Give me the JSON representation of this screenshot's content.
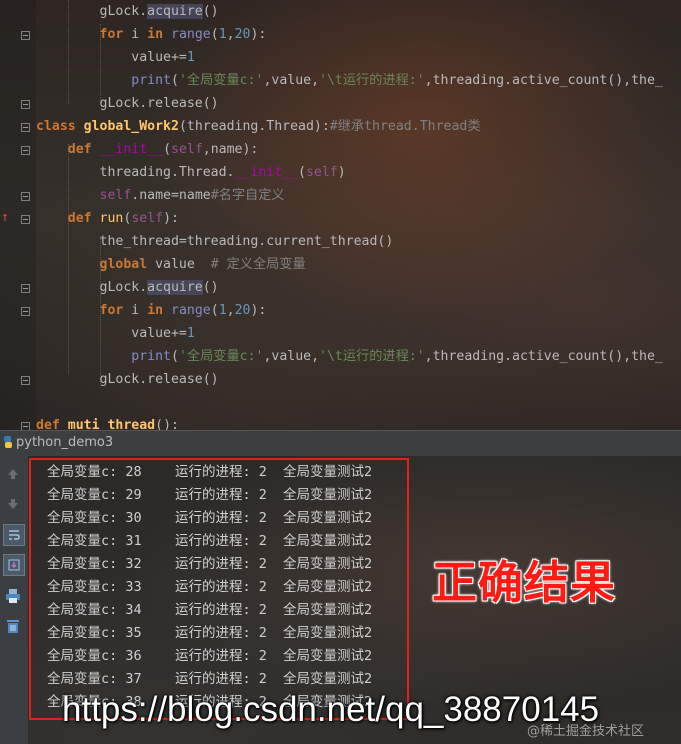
{
  "code_lines": [
    [
      [
        "plain",
        "        gLock."
      ],
      [
        "hlfn",
        "acquire"
      ],
      [
        "plain",
        "()"
      ]
    ],
    [
      [
        "plain",
        "        "
      ],
      [
        "kw",
        "for"
      ],
      [
        "plain",
        " i "
      ],
      [
        "kw",
        "in"
      ],
      [
        "plain",
        " "
      ],
      [
        "bi",
        "range"
      ],
      [
        "plain",
        "("
      ],
      [
        "num",
        "1"
      ],
      [
        "plain",
        ","
      ],
      [
        "num",
        "20"
      ],
      [
        "plain",
        "):"
      ]
    ],
    [
      [
        "plain",
        "            value+="
      ],
      [
        "num",
        "1"
      ]
    ],
    [
      [
        "plain",
        "            "
      ],
      [
        "bi",
        "print"
      ],
      [
        "plain",
        "("
      ],
      [
        "str",
        "'全局变量c:'"
      ],
      [
        "plain",
        ",value,"
      ],
      [
        "str",
        "'\\t运行的进程:'"
      ],
      [
        "plain",
        ",threading.active_count(),the_"
      ]
    ],
    [
      [
        "plain",
        "        gLock.release()"
      ]
    ],
    [
      [
        "kw",
        "class"
      ],
      [
        "plain",
        " "
      ],
      [
        "def",
        "global_Work2"
      ],
      [
        "plain",
        "(threading.Thread):"
      ],
      [
        "cmt",
        "#继承thread.Thread类"
      ]
    ],
    [
      [
        "plain",
        "    "
      ],
      [
        "kw",
        "def"
      ],
      [
        "plain",
        " "
      ],
      [
        "magic",
        "__init__"
      ],
      [
        "plain",
        "("
      ],
      [
        "self",
        "self"
      ],
      [
        "plain",
        ",name):"
      ]
    ],
    [
      [
        "plain",
        "        threading.Thread."
      ],
      [
        "magic",
        "__init__"
      ],
      [
        "plain",
        "("
      ],
      [
        "self",
        "self"
      ],
      [
        "plain",
        ")"
      ]
    ],
    [
      [
        "plain",
        "        "
      ],
      [
        "self",
        "self"
      ],
      [
        "plain",
        ".name=name"
      ],
      [
        "cmt",
        "#名字自定义"
      ]
    ],
    [
      [
        "plain",
        "    "
      ],
      [
        "kw",
        "def"
      ],
      [
        "plain",
        " "
      ],
      [
        "fn",
        "run"
      ],
      [
        "plain",
        "("
      ],
      [
        "self",
        "self"
      ],
      [
        "plain",
        "):"
      ]
    ],
    [
      [
        "plain",
        "        the_thread=threading.current_thread()"
      ]
    ],
    [
      [
        "plain",
        "        "
      ],
      [
        "kw",
        "global"
      ],
      [
        "plain",
        " value  "
      ],
      [
        "cmt",
        "# 定义全局变量"
      ]
    ],
    [
      [
        "plain",
        "        gLock."
      ],
      [
        "hlfn",
        "acquire"
      ],
      [
        "plain",
        "()"
      ]
    ],
    [
      [
        "plain",
        "        "
      ],
      [
        "kw",
        "for"
      ],
      [
        "plain",
        " i "
      ],
      [
        "kw",
        "in"
      ],
      [
        "plain",
        " "
      ],
      [
        "bi",
        "range"
      ],
      [
        "plain",
        "("
      ],
      [
        "num",
        "1"
      ],
      [
        "plain",
        ","
      ],
      [
        "num",
        "20"
      ],
      [
        "plain",
        "):"
      ]
    ],
    [
      [
        "plain",
        "            value+="
      ],
      [
        "num",
        "1"
      ]
    ],
    [
      [
        "plain",
        "            "
      ],
      [
        "bi",
        "print"
      ],
      [
        "plain",
        "("
      ],
      [
        "str",
        "'全局变量c:'"
      ],
      [
        "plain",
        ",value,"
      ],
      [
        "str",
        "'\\t运行的进程:'"
      ],
      [
        "plain",
        ",threading.active_count(),the_"
      ]
    ],
    [
      [
        "plain",
        "        gLock.release()"
      ]
    ],
    [
      [
        "plain",
        ""
      ]
    ],
    [
      [
        "kw",
        "def"
      ],
      [
        "plain",
        " "
      ],
      [
        "def",
        "muti_thread"
      ],
      [
        "plain",
        "():"
      ]
    ]
  ],
  "run_panel": {
    "title": "python_demo3"
  },
  "output_lines": [
    {
      "a": "全局变量c: 28",
      "b": "运行的进程: 2",
      "c": "全局变量测试2"
    },
    {
      "a": "全局变量c: 29",
      "b": "运行的进程: 2",
      "c": "全局变量测试2"
    },
    {
      "a": "全局变量c: 30",
      "b": "运行的进程: 2",
      "c": "全局变量测试2"
    },
    {
      "a": "全局变量c: 31",
      "b": "运行的进程: 2",
      "c": "全局变量测试2"
    },
    {
      "a": "全局变量c: 32",
      "b": "运行的进程: 2",
      "c": "全局变量测试2"
    },
    {
      "a": "全局变量c: 33",
      "b": "运行的进程: 2",
      "c": "全局变量测试2"
    },
    {
      "a": "全局变量c: 34",
      "b": "运行的进程: 2",
      "c": "全局变量测试2"
    },
    {
      "a": "全局变量c: 35",
      "b": "运行的进程: 2",
      "c": "全局变量测试2"
    },
    {
      "a": "全局变量c: 36",
      "b": "运行的进程: 2",
      "c": "全局变量测试2"
    },
    {
      "a": "全局变量c: 37",
      "b": "运行的进程: 2",
      "c": "全局变量测试2"
    },
    {
      "a": "全局变量c: 38",
      "b": "运行的进程: 2",
      "c": "全局变量测试2"
    }
  ],
  "annotation": {
    "label": "正确结果",
    "color": "#ff1a14"
  },
  "watermark": {
    "url": "https://blog.csdn.net/qq_38870145",
    "community": "@稀土掘金技术社区"
  },
  "toolbar_icons": [
    "arrow-up-icon",
    "arrow-down-icon",
    "wrap-icon",
    "scroll-end-icon",
    "print-icon",
    "trash-icon"
  ]
}
